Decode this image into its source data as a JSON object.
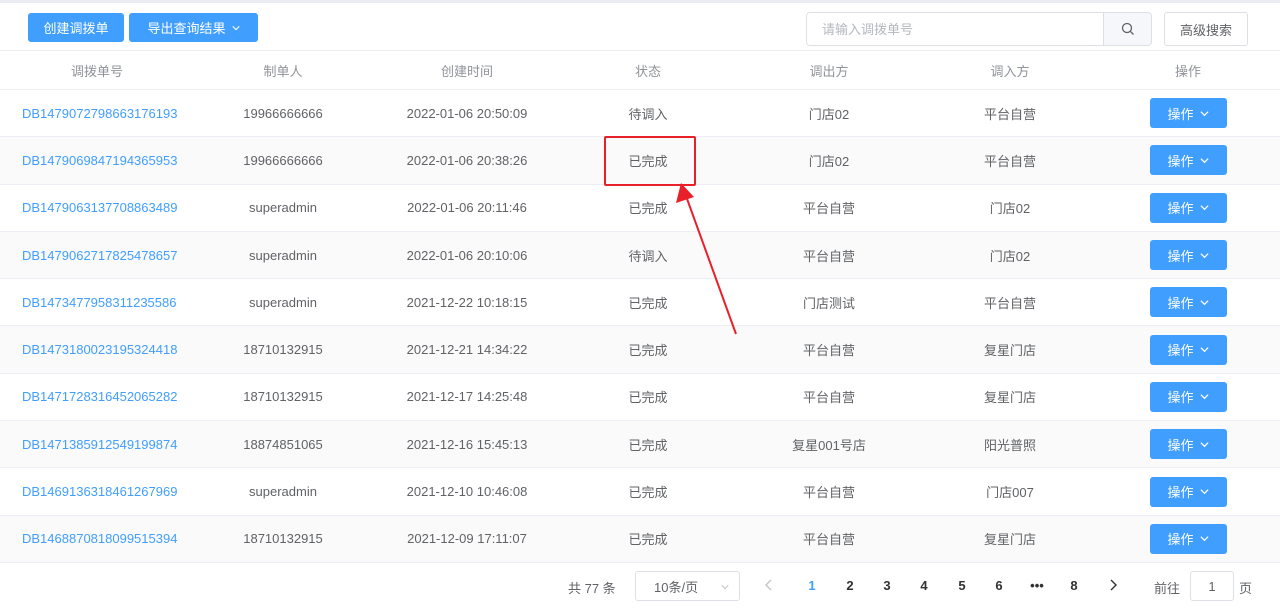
{
  "toolbar": {
    "create_label": "创建调拨单",
    "export_label": "导出查询结果",
    "search_placeholder": "请输入调拨单号",
    "advanced_label": "高级搜索"
  },
  "table": {
    "headers": [
      "调拨单号",
      "制单人",
      "创建时间",
      "状态",
      "调出方",
      "调入方",
      "操作"
    ],
    "rows": [
      {
        "id": "DB1479072798663176193",
        "creator": "19966666666",
        "time": "2022-01-06 20:50:09",
        "status": "待调入",
        "from": "门店02",
        "to": "平台自营",
        "op": "操作"
      },
      {
        "id": "DB1479069847194365953",
        "creator": "19966666666",
        "time": "2022-01-06 20:38:26",
        "status": "已完成",
        "from": "门店02",
        "to": "平台自营",
        "op": "操作"
      },
      {
        "id": "DB1479063137708863489",
        "creator": "superadmin",
        "time": "2022-01-06 20:11:46",
        "status": "已完成",
        "from": "平台自营",
        "to": "门店02",
        "op": "操作"
      },
      {
        "id": "DB1479062717825478657",
        "creator": "superadmin",
        "time": "2022-01-06 20:10:06",
        "status": "待调入",
        "from": "平台自营",
        "to": "门店02",
        "op": "操作"
      },
      {
        "id": "DB1473477958311235586",
        "creator": "superadmin",
        "time": "2021-12-22 10:18:15",
        "status": "已完成",
        "from": "门店测试",
        "to": "平台自营",
        "op": "操作"
      },
      {
        "id": "DB1473180023195324418",
        "creator": "18710132915",
        "time": "2021-12-21 14:34:22",
        "status": "已完成",
        "from": "平台自营",
        "to": "复星门店",
        "op": "操作"
      },
      {
        "id": "DB1471728316452065282",
        "creator": "18710132915",
        "time": "2021-12-17 14:25:48",
        "status": "已完成",
        "from": "平台自营",
        "to": "复星门店",
        "op": "操作"
      },
      {
        "id": "DB1471385912549199874",
        "creator": "18874851065",
        "time": "2021-12-16 15:45:13",
        "status": "已完成",
        "from": "复星001号店",
        "to": "阳光普照",
        "op": "操作"
      },
      {
        "id": "DB1469136318461267969",
        "creator": "superadmin",
        "time": "2021-12-10 10:46:08",
        "status": "已完成",
        "from": "平台自营",
        "to": "门店007",
        "op": "操作"
      },
      {
        "id": "DB1468870818099515394",
        "creator": "18710132915",
        "time": "2021-12-09 17:11:07",
        "status": "已完成",
        "from": "平台自营",
        "to": "复星门店",
        "op": "操作"
      }
    ]
  },
  "pagination": {
    "total_label": "共 77 条",
    "page_size": "10条/页",
    "pages": [
      "1",
      "2",
      "3",
      "4",
      "5",
      "6",
      "•••",
      "8"
    ],
    "current": "1",
    "goto_label": "前往",
    "goto_value": "1",
    "page_suffix": "页"
  },
  "annotation": {
    "color": "#e8202a"
  },
  "colors": {
    "primary": "#409eff",
    "border": "#dcdfe6"
  }
}
